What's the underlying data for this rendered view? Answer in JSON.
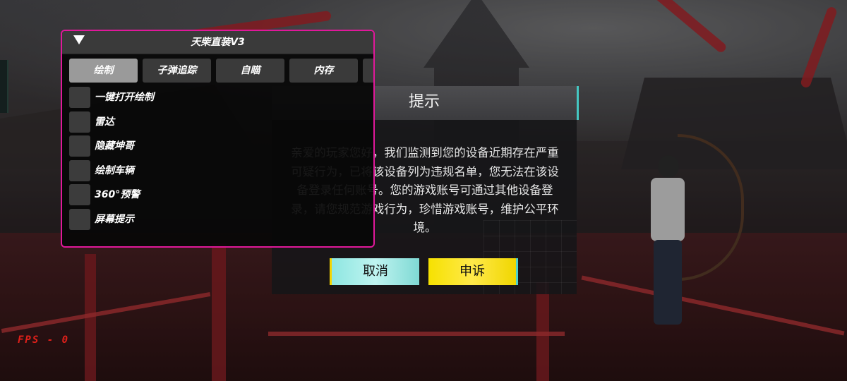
{
  "menu": {
    "title": "天柴直装V3",
    "collapse_icon": "triangle-down-icon",
    "border_color": "#e0189a",
    "tabs": [
      {
        "label": "绘制",
        "active": true
      },
      {
        "label": "子弹追踪",
        "active": false
      },
      {
        "label": "自瞄",
        "active": false
      },
      {
        "label": "内存",
        "active": false
      },
      {
        "label": "",
        "active": false
      }
    ],
    "options": [
      {
        "label": "一键打开绘制",
        "checked": false
      },
      {
        "label": "雷达",
        "checked": false
      },
      {
        "label": "隐藏坤哥",
        "checked": false
      },
      {
        "label": "绘制车辆",
        "checked": false
      },
      {
        "label": "360°预警",
        "checked": false
      },
      {
        "label": "屏幕提示",
        "checked": false
      }
    ]
  },
  "dialog": {
    "title": "提示",
    "message": "亲爱的玩家您好，我们监测到您的设备近期存在严重可疑行为，已将该设备列为违规名单，您无法在该设备登录任何账号。您的游戏账号可通过其他设备登录，请您规范游戏行为，珍惜游戏账号，维护公平环境。",
    "cancel_label": "取消",
    "appeal_label": "申诉",
    "cancel_color": "#8ee6e1",
    "appeal_color": "#f6e100"
  },
  "hud": {
    "fps_text": "FPS - 0",
    "fps_color": "#e0201a"
  }
}
